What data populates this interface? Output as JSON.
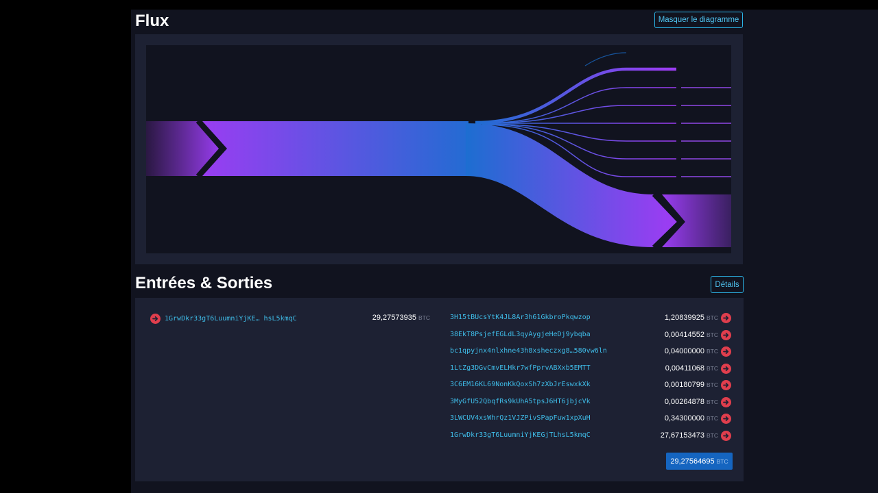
{
  "flux": {
    "title": "Flux",
    "hide_button_label": "Masquer le diagramme"
  },
  "io": {
    "title": "Entrées & Sorties",
    "details_button_label": "Détails",
    "unit": "BTC",
    "inputs": [
      {
        "address": "1GrwDkr33gT6LuumniYjKE… hsL5kmqC",
        "amount": "29,27573935"
      }
    ],
    "outputs": [
      {
        "address": "3H15tBUcsYtK4JL8Ar3h61GkbroPkqwzop",
        "amount": "1,20839925"
      },
      {
        "address": "38EkT8PsjefEGLdL3qyAygjeHeDj9ybqba",
        "amount": "0,00414552"
      },
      {
        "address": "bc1qpyjnx4nlxhne43h8xsheczxg8…580vw6ln",
        "amount": "0,04000000"
      },
      {
        "address": "1LtZg3DGvCmvELHkr7wfPprvABXxb5EMTT",
        "amount": "0,00411068"
      },
      {
        "address": "3C6EM16KL69NonKkQoxSh7zXbJrEswxkXk",
        "amount": "0,00180799"
      },
      {
        "address": "3MyGfU52QbqfRs9kUhA5tpsJ6HT6jbjcVk",
        "amount": "0,00264878"
      },
      {
        "address": "3LWCUV4xsWhrQz1VJZPivSPapFuw1xpXuH",
        "amount": "0,34300000"
      },
      {
        "address": "1GrwDkr33gT6LuumniYjKEGjTLhsL5kmqC",
        "amount": "27,67153473"
      }
    ],
    "total": "29,27564695"
  },
  "colors": {
    "purple": "#9a3df2",
    "blue": "#1a6fd0",
    "accent": "#2bb3e6",
    "danger": "#e03e4d",
    "total_badge": "#1565c0"
  }
}
